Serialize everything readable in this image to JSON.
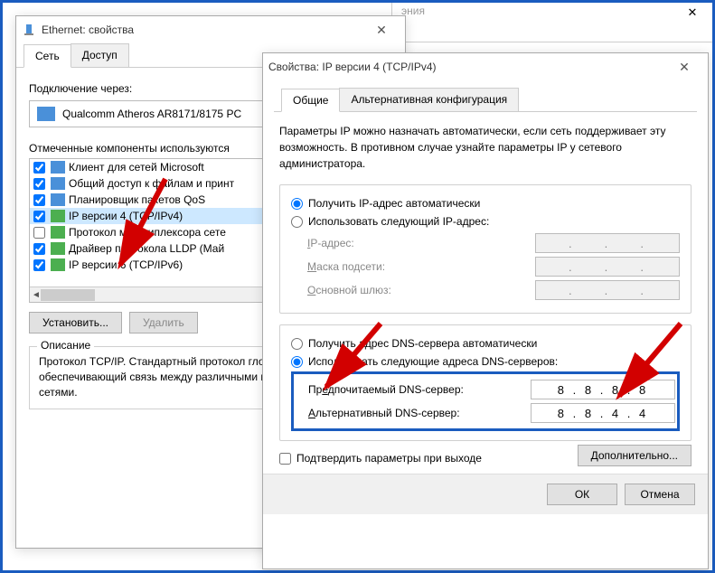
{
  "bg_text": "эния",
  "win1": {
    "title": "Ethernet: свойства",
    "tabs": {
      "network": "Сеть",
      "access": "Доступ"
    },
    "connect_via": "Подключение через:",
    "adapter": "Qualcomm Atheros AR8171/8175 PC",
    "components_label": "Отмеченные компоненты используются",
    "components": [
      {
        "checked": true,
        "iconClass": "ci-blue",
        "label": "Клиент для сетей Microsoft",
        "sel": false
      },
      {
        "checked": true,
        "iconClass": "ci-blue",
        "label": "Общий доступ к файлам и принт",
        "sel": false
      },
      {
        "checked": true,
        "iconClass": "ci-blue",
        "label": "Планировщик пакетов QoS",
        "sel": false
      },
      {
        "checked": true,
        "iconClass": "ci-green",
        "label": "IP версии 4 (TCP/IPv4)",
        "sel": true
      },
      {
        "checked": false,
        "iconClass": "ci-green",
        "label": "Протокол мультиплексора сете",
        "sel": false
      },
      {
        "checked": true,
        "iconClass": "ci-green",
        "label": "Драйвер протокола LLDP (Май",
        "sel": false
      },
      {
        "checked": true,
        "iconClass": "ci-green",
        "label": "IP версии 6 (TCP/IPv6)",
        "sel": false
      }
    ],
    "buttons": {
      "install": "Установить...",
      "uninstall": "Удалить"
    },
    "desc_title": "Описание",
    "desc_text": "Протокол TCP/IP. Стандартный протокол глобальных сетей, обеспечивающий связь между различными взаимодействующими сетями."
  },
  "win2": {
    "title": "Свойства: IP версии 4 (TCP/IPv4)",
    "tabs": {
      "general": "Общие",
      "alt": "Альтернативная конфигурация"
    },
    "info": "Параметры IP можно назначать автоматически, если сеть поддерживает эту возможность. В противном случае узнайте параметры IP у сетевого администратора.",
    "ip_auto": "Получить IP-адрес автоматически",
    "ip_manual": "Использовать следующий IP-адрес:",
    "ip_addr": "IP-адрес:",
    "mask": "Маска подсети:",
    "gateway": "Основной шлюз:",
    "dns_auto": "Получить адрес DNS-сервера автоматически",
    "dns_manual": "Использовать следующие адреса DNS-серверов:",
    "dns_pref": "Предпочитаемый DNS-сервер:",
    "dns_alt": "Альтернативный DNS-сервер:",
    "dns_pref_value": "8 . 8 . 8 . 8",
    "dns_alt_value": "8 . 8 . 4 . 4",
    "validate": "Подтвердить параметры при выходе",
    "advanced": "Дополнительно...",
    "ok": "ОК",
    "cancel": "Отмена"
  }
}
